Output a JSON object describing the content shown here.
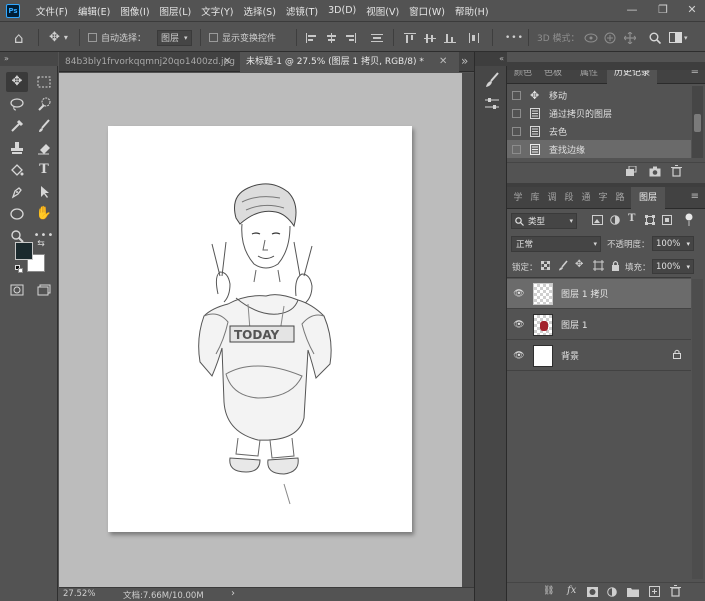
{
  "app": {
    "logo": "Ps"
  },
  "menubar": {
    "items": [
      "文件(F)",
      "编辑(E)",
      "图像(I)",
      "图层(L)",
      "文字(Y)",
      "选择(S)",
      "滤镜(T)",
      "3D(D)",
      "视图(V)",
      "窗口(W)",
      "帮助(H)"
    ],
    "minimize": "—",
    "restore": "❐",
    "close": "✕"
  },
  "options": {
    "home": "⌂",
    "move_glyph": "✥",
    "auto_select_label": "自动选择：",
    "auto_select_target": "图层",
    "show_transform_label": "显示变换控件",
    "more_glyph": "•••",
    "mode3d_label": "3D 模式："
  },
  "tabs": {
    "inactive_name": "84b3bly1frvorkqqmnj20qo1400zd.jpg",
    "active_name": "未标题-1 @ 27.5% (图层 1 拷贝, RGB/8) *",
    "close_glyph": "✕",
    "expand_glyph": "»"
  },
  "status": {
    "zoom": "27.52%",
    "doc_info": "文档:7.66M/10.00M",
    "arrow": "›"
  },
  "history_panel": {
    "tabs": [
      "颜色",
      "色板",
      "属性",
      "历史记录"
    ],
    "active_tab": 3,
    "entries": [
      "移动",
      "通过拷贝的图层",
      "去色",
      "查找边缘"
    ],
    "selected": 3
  },
  "layers_panel": {
    "tabs": [
      "学",
      "库",
      "调",
      "段",
      "通",
      "字",
      "路",
      "图层"
    ],
    "filter_label": "类型",
    "blend_mode": "正常",
    "opacity_label": "不透明度：",
    "opacity_value": "100%",
    "lock_label": "锁定：",
    "fill_label": "填充：",
    "fill_value": "100%",
    "layers": [
      {
        "name": "图层 1 拷贝",
        "selected": true
      },
      {
        "name": "图层 1",
        "selected": false
      },
      {
        "name": "背景",
        "selected": false,
        "locked": true
      }
    ]
  },
  "colors": {
    "foreground": "#1b2a2e",
    "background": "#ffffff",
    "panel": "#535353"
  }
}
